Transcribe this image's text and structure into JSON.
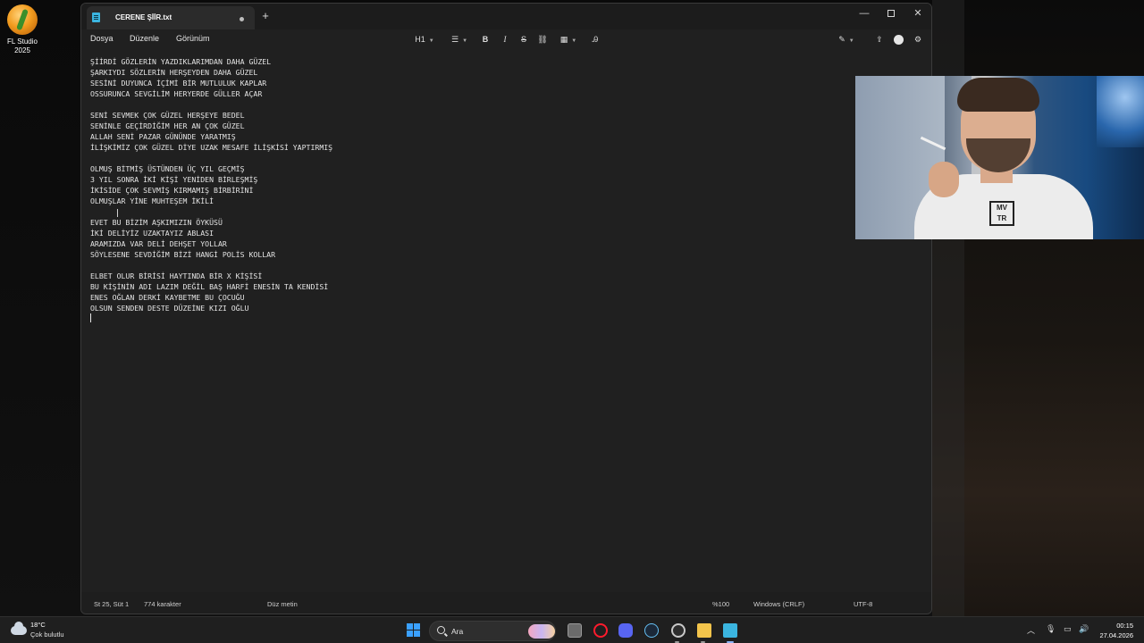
{
  "desktop": {
    "icons": [
      {
        "label": "FL Studio 2025"
      }
    ]
  },
  "window": {
    "tab_title": "CERENE ŞİİR.txt",
    "new_tab": "+",
    "controls": {
      "minimize": "—",
      "maximize": "",
      "close": "✕"
    }
  },
  "menu": {
    "file": "Dosya",
    "edit": "Düzenle",
    "view": "Görünüm"
  },
  "toolbar": {
    "heading": "H1",
    "bold": "B",
    "italic": "I",
    "strike": "S",
    "link_icon": "link-icon",
    "table_icon": "table-icon",
    "clear_format_icon": "clear-format-icon",
    "copilot_icon": "copilot-icon",
    "share_icon": "share-icon",
    "account_icon": "account-icon",
    "settings_icon": "gear-icon"
  },
  "editor": {
    "lines": [
      "ŞİİRDİ GÖZLERİN YAZDIKLARIMDAN DAHA GÜZEL",
      "ŞARKIYDI SÖZLERİN HERŞEYDEN DAHA GÜZEL",
      "SESİNİ DUYUNCA İÇİMİ BİR MUTLULUK KAPLAR",
      "OSSURUNCA SEVGİLİM HERYERDE GÜLLER AÇAR",
      "",
      "SENİ SEVMEK ÇOK GÜZEL HERŞEYE BEDEL",
      "SENİNLE GEÇİRDİĞİM HER AN ÇOK GÜZEL",
      "ALLAH SENİ PAZAR GÜNÜNDE YARATMIŞ",
      "İLİŞKİMİZ ÇOK GÜZEL DİYE UZAK MESAFE İLİŞKİSİ YAPTIRMIŞ",
      "",
      "OLMUŞ BİTMİŞ ÜSTÜNDEN ÜÇ YIL GEÇMİŞ",
      "3 YIL SONRA İKİ KİŞİ YENİDEN BİRLEŞMİŞ",
      "İKİSİDE ÇOK SEVMİŞ KIRMAMIŞ BİRBİRİNİ",
      "OLMUŞLAR YİNE MUHTEŞEM İKİLİ",
      "",
      "EVET BU BİZİM AŞKIMIZIN ÖYKÜSÜ",
      "İKİ DELİYİZ UZAKTAYIZ ABLASI",
      "ARAMIZDA VAR DELİ DEHŞET YOLLAR",
      "SÖYLESENE SEVDİĞİM BİZİ HANGİ POLİS KOLLAR",
      "",
      "ELBET OLUR BİRİSİ HAYTINDA BİR X KİŞİSİ",
      "BU KİŞİNİN ADI LAZIM DEĞİL BAŞ HARFİ ENESİN TA KENDİSİ",
      "ENES OĞLAN DERKİ KAYBETME BU ÇOCUĞU",
      "OLSUN SENDEN DESTE DÜZEİNE KIZI OĞLU",
      ""
    ]
  },
  "statusbar": {
    "position": "St 25, Süt 1",
    "chars": "774 karakter",
    "type": "Düz metin",
    "zoom": "%100",
    "eol": "Windows (CRLF)",
    "encoding": "UTF-8"
  },
  "taskbar": {
    "weather_temp": "18°C",
    "weather_desc": "Çok bulutlu",
    "search_placeholder": "Ara",
    "time": "00:15",
    "date": "27.04.2026"
  },
  "webcam": {
    "shirt_logo": "MV TR"
  },
  "colors": {
    "window_bg": "#202020",
    "accent": "#3aa0ff",
    "text": "#e4e4e4"
  }
}
